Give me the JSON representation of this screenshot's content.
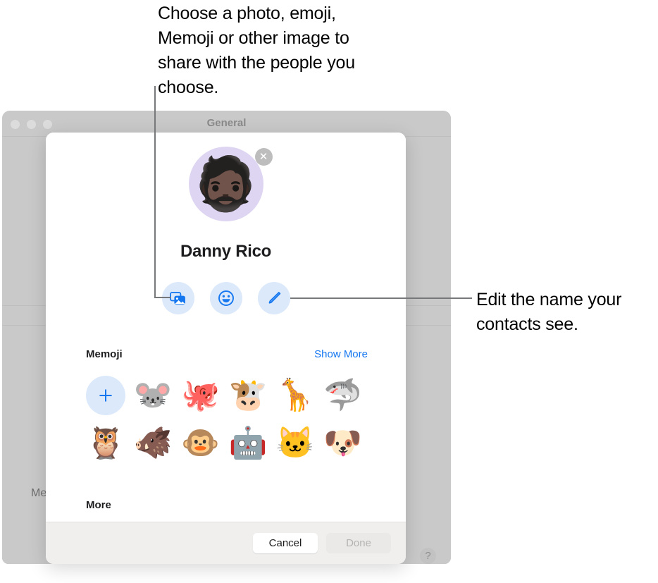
{
  "callouts": {
    "top": "Choose a photo, emoji, Memoji or other image to share with the people you choose.",
    "right": "Edit the name your contacts see."
  },
  "background_window": {
    "title": "General",
    "partial_label": "Me",
    "help_icon": "?"
  },
  "dialog": {
    "avatar": {
      "memoji_glyph": "🧔🏿",
      "remove_icon": "✕",
      "background_color": "#ded5f2"
    },
    "profile_name": "Danny Rico",
    "action_buttons": [
      {
        "name": "photos",
        "icon": "photos-icon"
      },
      {
        "name": "emoji",
        "icon": "smiley-icon"
      },
      {
        "name": "edit-name",
        "icon": "pencil-icon"
      }
    ],
    "memoji_section": {
      "title": "Memoji",
      "show_more": "Show More",
      "add_icon": "plus-icon",
      "items": [
        {
          "name": "add-memoji",
          "glyph": ""
        },
        {
          "name": "mouse",
          "glyph": "🐭"
        },
        {
          "name": "octopus",
          "glyph": "🐙"
        },
        {
          "name": "cow",
          "glyph": "🐮"
        },
        {
          "name": "giraffe",
          "glyph": "🦒"
        },
        {
          "name": "shark",
          "glyph": "🦈"
        },
        {
          "name": "owl",
          "glyph": "🦉"
        },
        {
          "name": "boar",
          "glyph": "🐗"
        },
        {
          "name": "monkey",
          "glyph": "🐵"
        },
        {
          "name": "robot",
          "glyph": "🤖"
        },
        {
          "name": "cat",
          "glyph": "🐱"
        },
        {
          "name": "dog",
          "glyph": "🐶"
        }
      ]
    },
    "more_section": {
      "title": "More"
    },
    "footer": {
      "cancel_label": "Cancel",
      "done_label": "Done"
    }
  },
  "colors": {
    "accent_blue": "#1477f0",
    "button_tint": "#dbe9fb",
    "window_chrome": "#c9c9c9",
    "footer_bg": "#f0efee"
  }
}
